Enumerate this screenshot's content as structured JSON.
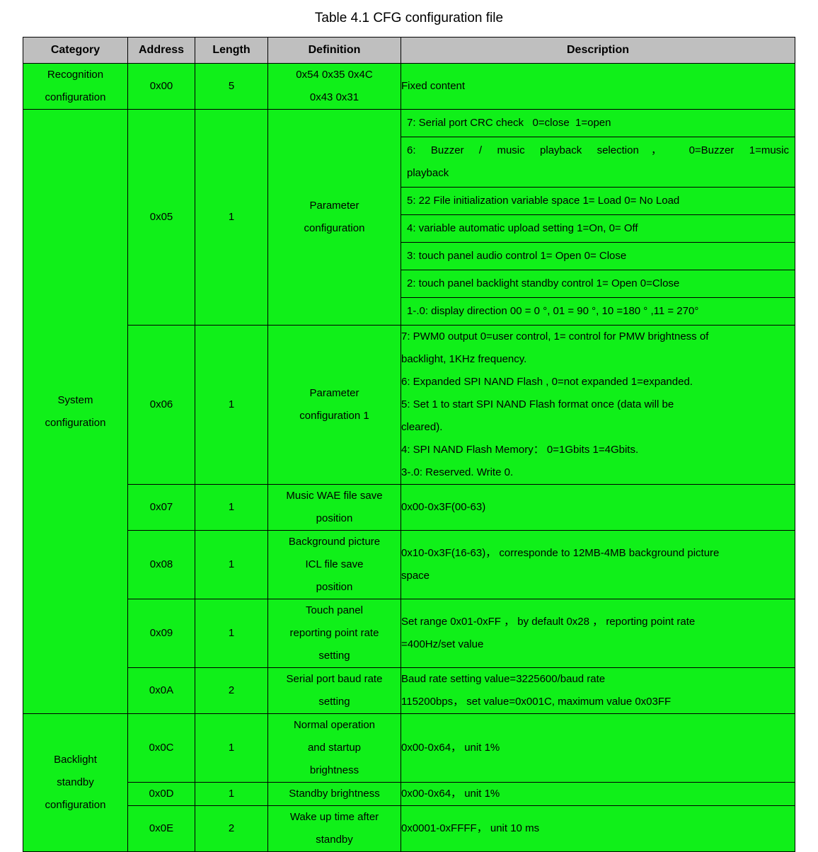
{
  "title": "Table 4.1 CFG configuration file",
  "table": {
    "columns": [
      {
        "key": "category",
        "label": "Category"
      },
      {
        "key": "address",
        "label": "Address"
      },
      {
        "key": "length",
        "label": "Length"
      },
      {
        "key": "definition",
        "label": "Definition"
      },
      {
        "key": "description",
        "label": "Description"
      }
    ],
    "colors": {
      "header_bg": "#bfbfbf",
      "row_bg": "#10f019",
      "border": "#000000",
      "text": "#000000"
    },
    "categories": [
      {
        "id": "recognition",
        "label_line1": "Recognition",
        "label_line2": "configuration"
      },
      {
        "id": "system",
        "label_line1": "System",
        "label_line2": "configuration"
      },
      {
        "id": "backlight",
        "label_line1": "Backlight",
        "label_line2": "standby",
        "label_line3": "configuration"
      }
    ],
    "rows": [
      {
        "id": "row-0x00",
        "category": "recognition",
        "address": "0x00",
        "length": "5",
        "definition_line1": "0x54 0x35 0x4C",
        "definition_line2": "0x43 0x31",
        "description_line1": "Fixed content"
      },
      {
        "id": "row-0x05",
        "category": "system",
        "address": "0x05",
        "length": "1",
        "definition_line1": "Parameter",
        "definition_line2": "configuration",
        "description_subrows": [
          "7: Serial port CRC check   0=close  1=open",
          "6: Buzzer / music playback selection， 0=Buzzer  1=music",
          "playback",
          "5: 22 File initialization variable space 1= Load 0= No Load",
          "4: variable automatic upload setting 1=On, 0= Off",
          "3: touch panel audio control 1= Open 0= Close",
          "2: touch panel backlight standby control 1= Open 0=Close",
          "1-.0: display direction 00 = 0 °, 01 = 90 °, 10 =180 ° ,11 = 270°"
        ]
      },
      {
        "id": "row-0x06",
        "category": "system",
        "address": "0x06",
        "length": "1",
        "definition_line1": "Parameter",
        "definition_line2": "configuration 1",
        "description_lines": [
          "7: PWM0 output 0=user control, 1= control for PMW brightness of",
          "backlight, 1KHz frequency.",
          "6: Expanded SPI NAND Flash , 0=not expanded 1=expanded.",
          "5: Set 1 to start SPI NAND Flash format once (data will  be",
          "cleared).",
          "4: SPI NAND Flash Memory： 0=1Gbits 1=4Gbits.",
          "3-.0: Reserved. Write 0."
        ]
      },
      {
        "id": "row-0x07",
        "category": "system",
        "address": "0x07",
        "length": "1",
        "definition_line1": "Music WAE file save",
        "definition_line2": "position",
        "description_line1": "0x00-0x3F(00-63)"
      },
      {
        "id": "row-0x08",
        "category": "system",
        "address": "0x08",
        "length": "1",
        "definition_line1": "Background picture",
        "definition_line2": "ICL file save",
        "definition_line3": "position",
        "description_line1": "0x10-0x3F(16-63)， corresponde to 12MB-4MB background picture",
        "description_line2": "space"
      },
      {
        "id": "row-0x09",
        "category": "system",
        "address": "0x09",
        "length": "1",
        "definition_line1": "Touch panel",
        "definition_line2": "reporting point rate",
        "definition_line3": "setting",
        "description_line1": "Set range 0x01-0xFF ，   by default 0x28 ，    reporting point  rate",
        "description_line2": "=400Hz/set value"
      },
      {
        "id": "row-0x0A",
        "category": "system",
        "address": "0x0A",
        "length": "2",
        "definition_line1": "Serial port baud rate",
        "definition_line2": "setting",
        "description_line1": "Baud rate setting value=3225600/baud rate",
        "description_line2": "115200bps， set value=0x001C, maximum value 0x03FF"
      },
      {
        "id": "row-0x0C",
        "category": "backlight",
        "address": "0x0C",
        "length": "1",
        "definition_line1": "Normal operation",
        "definition_line2": "and startup",
        "definition_line3": "brightness",
        "description_line1": "0x00-0x64， unit 1%"
      },
      {
        "id": "row-0x0D",
        "category": "backlight",
        "address": "0x0D",
        "length": "1",
        "definition_line1": "Standby brightness",
        "description_line1": "0x00-0x64， unit 1%"
      },
      {
        "id": "row-0x0E",
        "category": "backlight",
        "address": "0x0E",
        "length": "2",
        "definition_line1": "Wake up time after",
        "definition_line2": "standby",
        "description_line1": "0x0001-0xFFFF， unit 10 ms"
      }
    ]
  }
}
